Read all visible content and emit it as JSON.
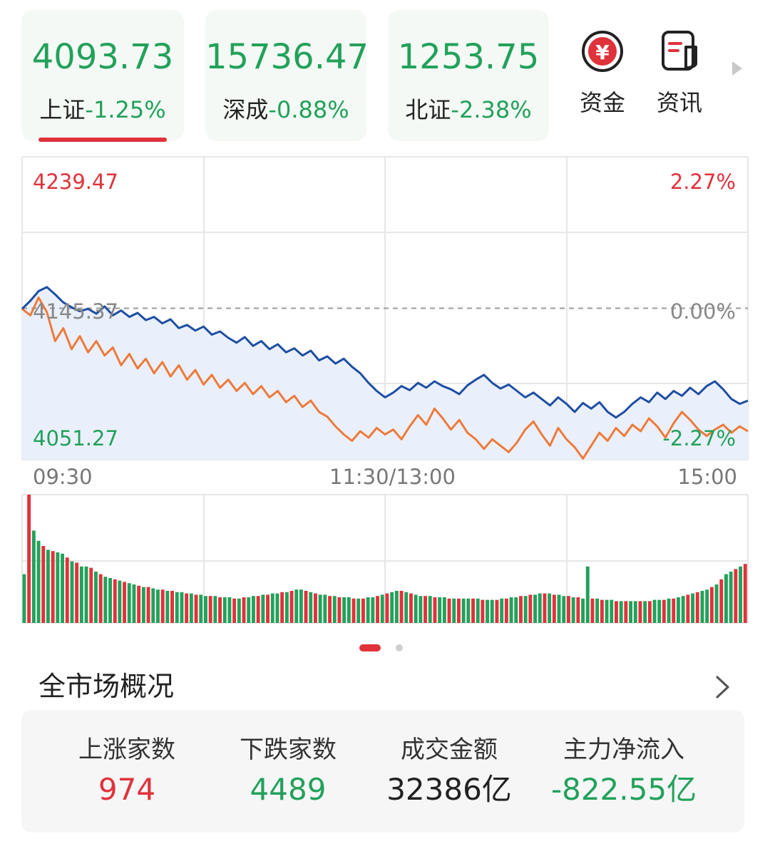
{
  "indices": [
    {
      "value": "4093.73",
      "name": "上证",
      "change": "-1.25%"
    },
    {
      "value": "15736.47",
      "name": "深成",
      "change": "-0.88%"
    },
    {
      "value": "1253.75",
      "name": "北证",
      "change": "-2.38%"
    }
  ],
  "tools": [
    {
      "label": "资金",
      "icon": "yuan-coin-icon",
      "glyph": "¥"
    },
    {
      "label": "资讯",
      "icon": "news-icon"
    }
  ],
  "chart": {
    "top_left": "4239.47",
    "top_right": "2.27%",
    "mid_left": "4145.37",
    "mid_right": "0.00%",
    "bottom_left": "4051.27",
    "bottom_right": "-2.27%",
    "time_start": "09:30",
    "time_mid": "11:30/13:00",
    "time_end": "15:00"
  },
  "colors": {
    "up": "#e0323a",
    "down": "#22a15a",
    "index_line": "#1d4ea3",
    "avg_line": "#ee7a3a"
  },
  "chart_data": {
    "type": "line",
    "y_range": [
      4051.27,
      4239.47
    ],
    "pct_range": [
      -2.27,
      2.27
    ],
    "baseline": 4145.37,
    "series": [
      {
        "values": [
          4145.0,
          4150.0,
          4156.0,
          4158.5,
          4154.0,
          4149.0,
          4146.0,
          4143.5,
          4145.0,
          4142.0,
          4146.5,
          4141.0,
          4144.0,
          4140.0,
          4142.5,
          4138.0,
          4140.0,
          4136.0,
          4138.5,
          4133.0,
          4135.0,
          4131.5,
          4134.0,
          4129.0,
          4131.0,
          4127.0,
          4124.0,
          4127.5,
          4122.0,
          4125.0,
          4120.0,
          4123.0,
          4118.0,
          4120.5,
          4116.0,
          4119.0,
          4113.0,
          4115.5,
          4111.0,
          4114.0,
          4109.0,
          4105.0,
          4099.0,
          4094.0,
          4090.0,
          4093.0,
          4097.0,
          4094.5,
          4099.0,
          4096.0,
          4100.0,
          4097.0,
          4095.0,
          4092.0,
          4097.5,
          4101.0,
          4104.0,
          4099.0,
          4095.5,
          4098.0,
          4094.0,
          4090.0,
          4093.0,
          4089.0,
          4085.0,
          4090.0,
          4086.0,
          4081.0,
          4086.5,
          4083.0,
          4087.0,
          4081.0,
          4077.5,
          4081.0,
          4086.0,
          4090.0,
          4087.0,
          4093.0,
          4089.0,
          4094.0,
          4091.0,
          4096.0,
          4092.0,
          4097.0,
          4100.0,
          4095.0,
          4089.0,
          4086.0,
          4088.0
        ]
      },
      {
        "values": [
          4145.0,
          4141.0,
          4152.0,
          4143.0,
          4125.0,
          4133.0,
          4120.0,
          4128.0,
          4118.0,
          4125.0,
          4116.0,
          4121.0,
          4110.0,
          4117.0,
          4108.0,
          4114.0,
          4105.0,
          4112.0,
          4103.0,
          4110.0,
          4101.0,
          4107.0,
          4098.0,
          4104.0,
          4096.0,
          4101.0,
          4094.0,
          4099.0,
          4092.0,
          4097.0,
          4090.0,
          4094.0,
          4087.0,
          4091.0,
          4084.0,
          4088.0,
          4081.0,
          4078.0,
          4072.0,
          4067.0,
          4063.0,
          4069.0,
          4065.0,
          4071.0,
          4067.0,
          4070.0,
          4064.0,
          4072.0,
          4079.0,
          4073.0,
          4083.0,
          4077.0,
          4070.0,
          4076.0,
          4068.0,
          4064.0,
          4058.0,
          4064.0,
          4060.0,
          4056.0,
          4062.0,
          4070.0,
          4075.0,
          4067.0,
          4060.0,
          4071.0,
          4064.0,
          4059.0,
          4052.0,
          4060.0,
          4068.0,
          4063.0,
          4071.0,
          4066.0,
          4073.0,
          4069.0,
          4077.0,
          4072.0,
          4065.0,
          4074.0,
          4081.0,
          4076.0,
          4070.0,
          4066.0,
          4070.0,
          4073.0,
          4068.0,
          4072.0,
          4069.0
        ]
      }
    ]
  },
  "volume_data": {
    "type": "bar",
    "values": [
      38,
      100,
      72,
      64,
      60,
      57,
      56,
      55,
      54,
      51,
      48,
      47,
      44,
      44,
      43,
      40,
      38,
      36,
      35,
      34,
      33,
      32,
      31,
      30,
      29,
      28,
      28,
      27,
      26,
      26,
      25,
      25,
      24,
      24,
      23,
      23,
      22,
      22,
      21,
      21,
      21,
      20,
      20,
      20,
      19,
      19,
      20,
      20,
      21,
      21,
      22,
      22,
      23,
      23,
      24,
      24,
      25,
      26,
      26,
      25,
      24,
      23,
      22,
      22,
      21,
      21,
      20,
      20,
      20,
      19,
      19,
      19,
      20,
      20,
      21,
      22,
      23,
      24,
      25,
      25,
      24,
      23,
      22,
      21,
      21,
      21,
      20,
      20,
      20,
      19,
      19,
      19,
      19,
      19,
      19,
      19,
      18,
      18,
      18,
      18,
      19,
      19,
      20,
      20,
      21,
      21,
      22,
      22,
      23,
      23,
      23,
      22,
      22,
      21,
      21,
      20,
      20,
      19,
      19,
      19,
      19,
      18,
      18,
      18,
      17,
      17,
      17,
      17,
      17,
      17,
      17,
      17,
      18,
      18,
      18,
      19,
      19,
      20,
      21,
      22,
      23,
      24,
      25,
      26,
      28,
      30,
      34,
      38,
      40,
      42,
      44,
      46
    ],
    "spike_index": 118,
    "spike_value": 44
  },
  "overview": {
    "title": "全市场概况",
    "stats": [
      {
        "label": "上涨家数",
        "value": "974"
      },
      {
        "label": "下跌家数",
        "value": "4489"
      },
      {
        "label": "成交金额",
        "value": "32386亿"
      },
      {
        "label": "主力净流入",
        "value": "-822.55亿"
      }
    ]
  }
}
